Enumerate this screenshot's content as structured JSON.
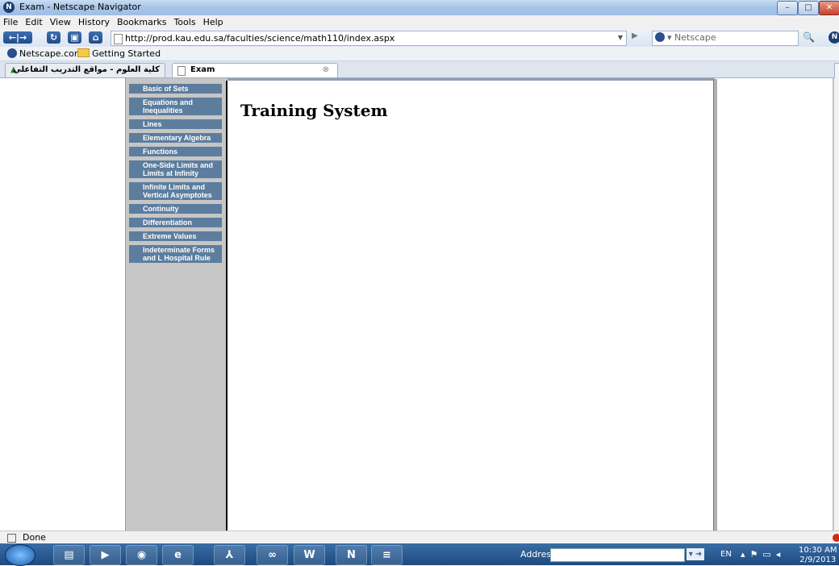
{
  "window": {
    "title": "Exam - Netscape Navigator"
  },
  "menubar": [
    "File",
    "Edit",
    "View",
    "History",
    "Bookmarks",
    "Tools",
    "Help"
  ],
  "navbar": {
    "url": "http://prod.kau.edu.sa/faculties/science/math110/index.aspx",
    "search_engine": "Netscape"
  },
  "bookmarks": [
    {
      "label": "Netscape.com",
      "icon": "netscape-icon"
    },
    {
      "label": "Getting Started",
      "icon": "folder-icon"
    }
  ],
  "tabs": [
    {
      "label": "كلية العلوم - مواقع التدريب التفاعلي",
      "active": false
    },
    {
      "label": "Exam",
      "active": true
    }
  ],
  "sidebar": {
    "items": [
      {
        "line1": "Basic of Sets",
        "line2": ""
      },
      {
        "line1": "Equations and",
        "line2": "Inequalities"
      },
      {
        "line1": "Lines",
        "line2": ""
      },
      {
        "line1": "Elementary Algebra",
        "line2": ""
      },
      {
        "line1": "Functions",
        "line2": ""
      },
      {
        "line1": "One-Side Limits and",
        "line2": "Limits at Infinity"
      },
      {
        "line1": "Infinite Limits and",
        "line2": "Vertical Asymptotes"
      },
      {
        "line1": "Continuity",
        "line2": ""
      },
      {
        "line1": "Differentiation",
        "line2": ""
      },
      {
        "line1": "Extreme Values",
        "line2": ""
      },
      {
        "line1": "Indeterminate Forms",
        "line2": "and L Hospital Rule"
      }
    ]
  },
  "main": {
    "heading": "Training System"
  },
  "status": {
    "text": "Done"
  },
  "taskbar": {
    "address_label": "Address",
    "language": "EN",
    "time": "10:30 AM",
    "date": "2/9/2013"
  }
}
